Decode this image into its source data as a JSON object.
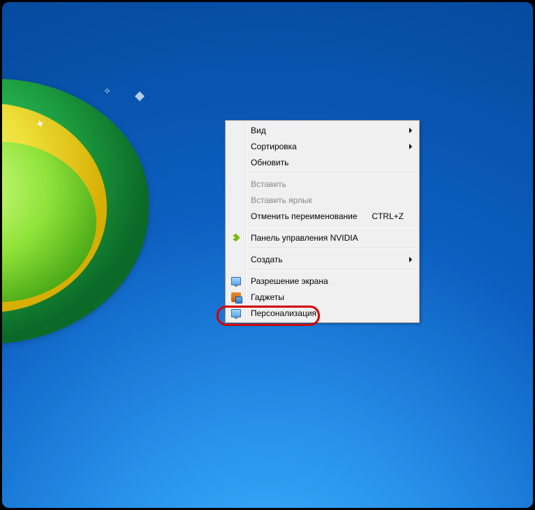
{
  "menu": {
    "view": {
      "label": "Вид"
    },
    "sort": {
      "label": "Сортировка"
    },
    "refresh": {
      "label": "Обновить"
    },
    "paste": {
      "label": "Вставить"
    },
    "paste_shortcut": {
      "label": "Вставить ярлык"
    },
    "undo_rename": {
      "label": "Отменить переименование",
      "shortcut": "CTRL+Z"
    },
    "nvidia": {
      "label": "Панель управления NVIDIA"
    },
    "new": {
      "label": "Создать"
    },
    "resolution": {
      "label": "Разрешение экрана"
    },
    "gadgets": {
      "label": "Гаджеты"
    },
    "personalize": {
      "label": "Персонализация"
    }
  }
}
